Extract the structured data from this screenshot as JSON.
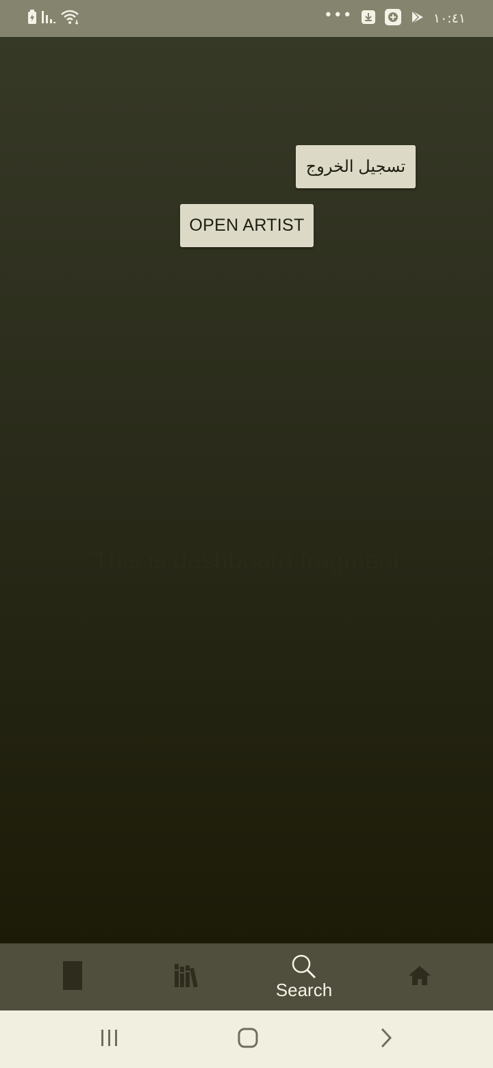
{
  "status_bar": {
    "time": "١٠:٤١",
    "more": "•••",
    "icons": [
      "battery-charging-icon",
      "signal-icon",
      "wifi-icon",
      "download-icon",
      "app-icon",
      "play-store-icon"
    ]
  },
  "main": {
    "logout_label": "تسجيل الخروج",
    "open_artist_label": "OPEN ARTIST",
    "fragment_text": "This is dashboard fragment"
  },
  "bottom_nav": {
    "items": [
      {
        "icon": "book-icon",
        "label": ""
      },
      {
        "icon": "library-icon",
        "label": ""
      },
      {
        "icon": "search-icon",
        "label": "Search"
      },
      {
        "icon": "home-icon",
        "label": ""
      }
    ],
    "active_index": 2
  },
  "system_nav": {
    "icons": [
      "recent-apps-icon",
      "home-button-icon",
      "back-icon"
    ]
  },
  "colors": {
    "status_bar": "#85846f",
    "bottom_nav": "#504e3c",
    "button": "#dcdac6",
    "system_nav": "#f1f0e0"
  }
}
